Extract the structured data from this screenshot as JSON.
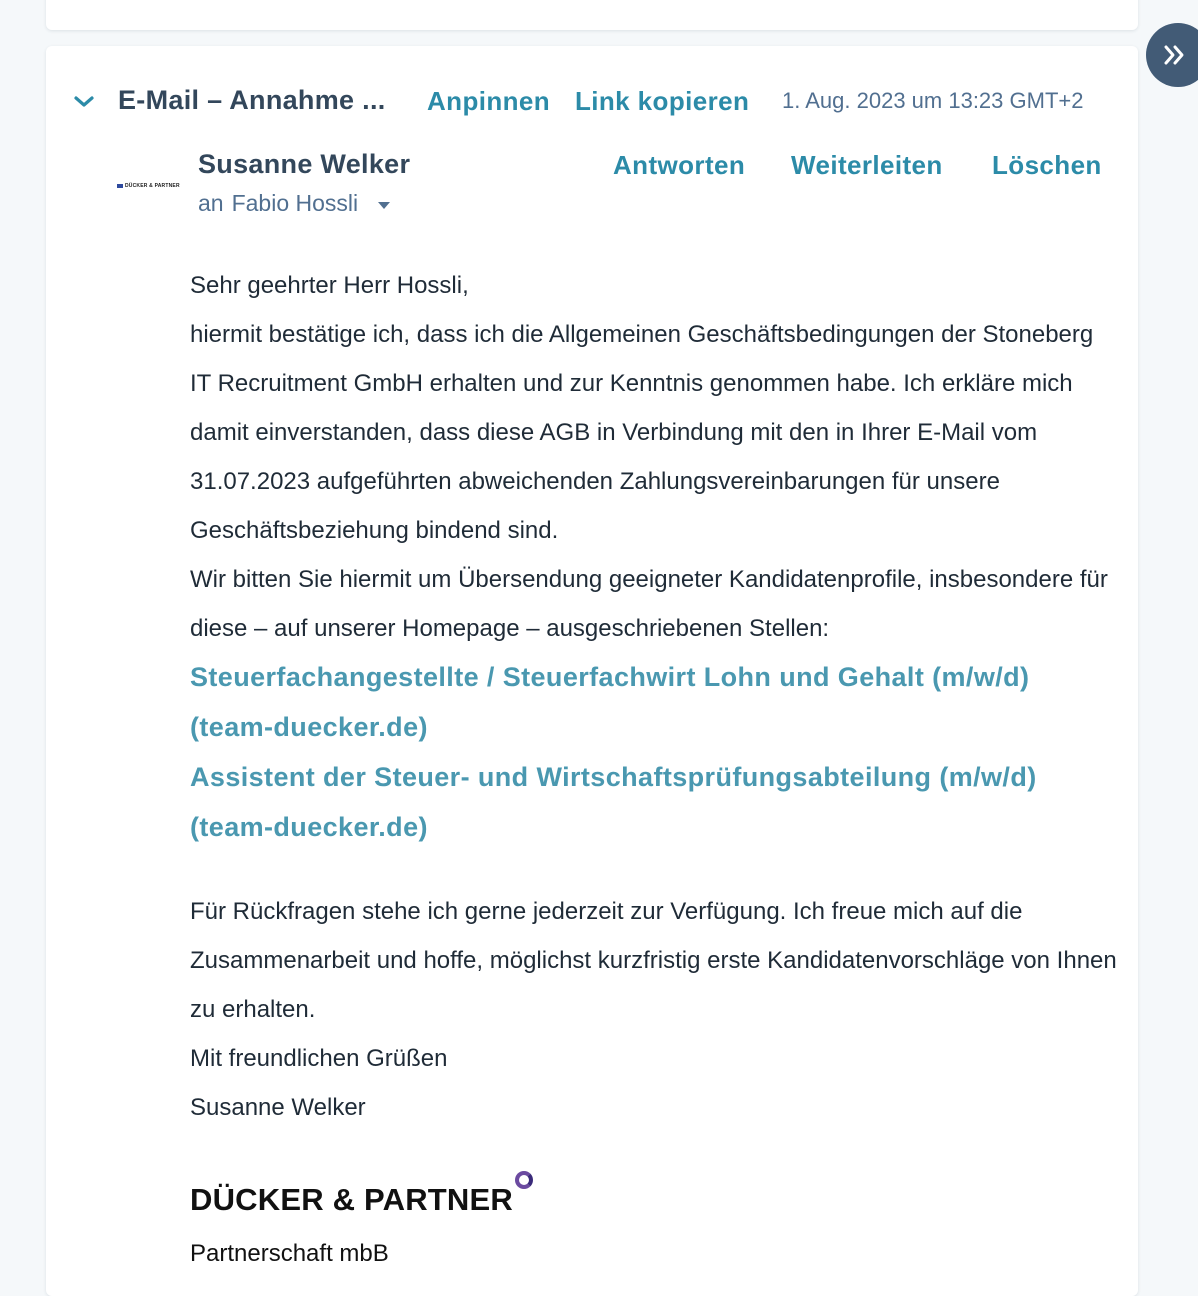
{
  "header": {
    "subject": "E-Mail – Annahme ...",
    "pin": "Anpinnen",
    "copy_link": "Link kopieren",
    "timestamp": "1. Aug. 2023 um 13:23 GMT+2"
  },
  "sender": {
    "name": "Susanne Welker",
    "recipient_prefix": "an",
    "recipient": "Fabio Hossli",
    "logo_text": "DÜCKER & PARTNER"
  },
  "actions": {
    "reply": "Antworten",
    "forward": "Weiterleiten",
    "delete": "Löschen"
  },
  "body": {
    "greeting": "Sehr geehrter Herr Hossli,",
    "paragraph1": "hiermit bestätige ich, dass ich die Allgemeinen Geschäftsbedingungen der Stoneberg IT Recruitment GmbH erhalten und zur Kenntnis genommen habe. Ich erkläre mich damit einverstanden, dass diese AGB in Verbindung mit den in Ihrer E-Mail vom 31.07.2023 aufgeführten abweichenden Zahlungsvereinbarungen für unsere Geschäftsbeziehung bindend sind.",
    "paragraph2": "Wir bitten Sie hiermit um Übersendung geeigneter Kandidatenprofile, insbesondere für diese – auf unserer Homepage – ausgeschriebenen Stellen:",
    "job_link_1": "Steuerfachangestellte / Steuerfachwirt Lohn und Gehalt (m/w/d) (team-duecker.de)",
    "job_link_2": "Assistent der Steuer- und Wirtschaftsprüfungsabteilung (m/w/d) (team-duecker.de)",
    "paragraph3": "Für Rückfragen stehe ich gerne jederzeit zur Verfügung. Ich freue mich auf die Zusammenarbeit und hoffe, möglichst kurzfristig erste Kandidatenvorschläge von Ihnen zu erhalten.",
    "closing": "Mit freundlichen Grüßen",
    "signature_name": "Susanne Welker"
  },
  "signature": {
    "brand": "DÜCKER & PARTNER",
    "subtitle": "Partnerschaft mbB"
  },
  "colors": {
    "accent": "#2c8ba8",
    "link": "#4a98b0",
    "text_dark": "#33475b",
    "text_muted": "#516f90",
    "expand_button": "#425b76"
  }
}
